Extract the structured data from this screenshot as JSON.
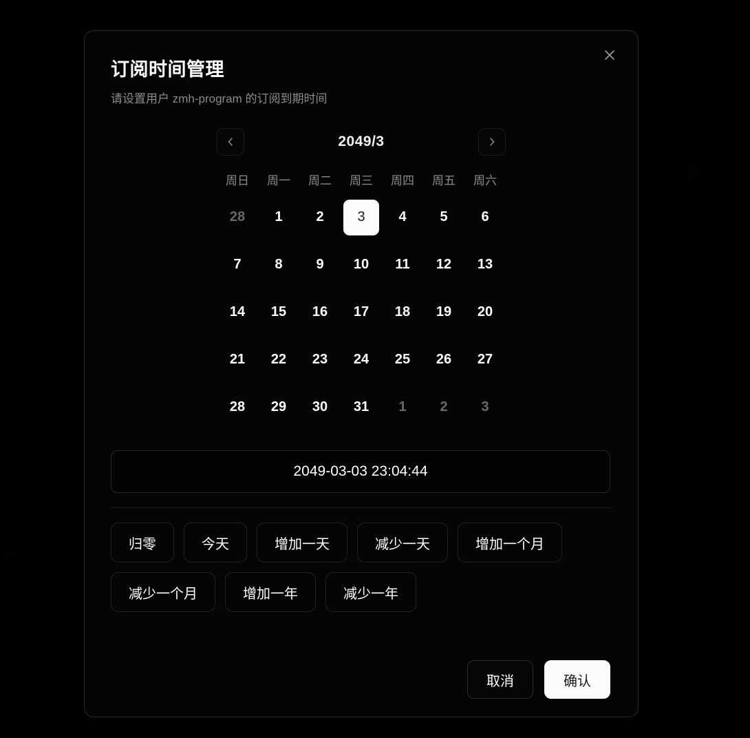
{
  "modal": {
    "title": "订阅时间管理",
    "subtitle": "请设置用户 zmh-program 的订阅到期时间",
    "close_icon": "close-icon"
  },
  "calendar": {
    "month_label": "2049/3",
    "prev_icon": "chevron-left-icon",
    "next_icon": "chevron-right-icon",
    "weekdays": [
      "周日",
      "周一",
      "周二",
      "周三",
      "周四",
      "周五",
      "周六"
    ],
    "weeks": [
      [
        {
          "label": "28",
          "state": "muted"
        },
        {
          "label": "1",
          "state": "normal"
        },
        {
          "label": "2",
          "state": "normal"
        },
        {
          "label": "3",
          "state": "selected"
        },
        {
          "label": "4",
          "state": "normal"
        },
        {
          "label": "5",
          "state": "normal"
        },
        {
          "label": "6",
          "state": "normal"
        }
      ],
      [
        {
          "label": "7",
          "state": "normal"
        },
        {
          "label": "8",
          "state": "normal"
        },
        {
          "label": "9",
          "state": "normal"
        },
        {
          "label": "10",
          "state": "normal"
        },
        {
          "label": "11",
          "state": "normal"
        },
        {
          "label": "12",
          "state": "normal"
        },
        {
          "label": "13",
          "state": "normal"
        }
      ],
      [
        {
          "label": "14",
          "state": "normal"
        },
        {
          "label": "15",
          "state": "normal"
        },
        {
          "label": "16",
          "state": "normal"
        },
        {
          "label": "17",
          "state": "normal"
        },
        {
          "label": "18",
          "state": "normal"
        },
        {
          "label": "19",
          "state": "normal"
        },
        {
          "label": "20",
          "state": "normal"
        }
      ],
      [
        {
          "label": "21",
          "state": "normal"
        },
        {
          "label": "22",
          "state": "normal"
        },
        {
          "label": "23",
          "state": "normal"
        },
        {
          "label": "24",
          "state": "normal"
        },
        {
          "label": "25",
          "state": "normal"
        },
        {
          "label": "26",
          "state": "normal"
        },
        {
          "label": "27",
          "state": "normal"
        }
      ],
      [
        {
          "label": "28",
          "state": "normal"
        },
        {
          "label": "29",
          "state": "normal"
        },
        {
          "label": "30",
          "state": "normal"
        },
        {
          "label": "31",
          "state": "normal"
        },
        {
          "label": "1",
          "state": "muted"
        },
        {
          "label": "2",
          "state": "muted"
        },
        {
          "label": "3",
          "state": "muted"
        }
      ]
    ]
  },
  "datetime": {
    "value": "2049-03-03 23:04:44"
  },
  "quick_actions": [
    {
      "label": "归零"
    },
    {
      "label": "今天"
    },
    {
      "label": "增加一天"
    },
    {
      "label": "减少一天"
    },
    {
      "label": "增加一个月"
    },
    {
      "label": "减少一个月"
    },
    {
      "label": "增加一年"
    },
    {
      "label": "减少一年"
    }
  ],
  "footer": {
    "cancel_label": "取消",
    "confirm_label": "确认"
  },
  "colors": {
    "modal_bg": "#050505",
    "modal_border": "#2a2a2a",
    "accent_selected": "#fbfbfb",
    "text_primary": "#ffffff",
    "text_muted": "#8b8b8b",
    "text_disabled": "#6a6a6a"
  }
}
